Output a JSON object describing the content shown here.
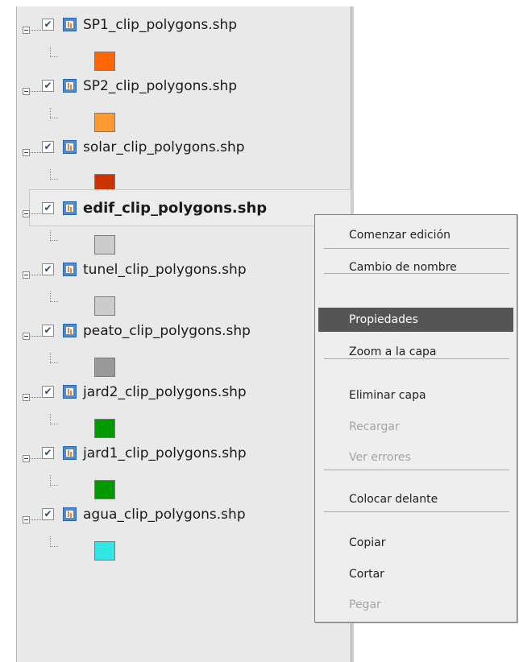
{
  "layers": [
    {
      "name": "SP1_clip_polygons.shp",
      "checked": true,
      "swatch_color": "#ff6600",
      "selected": false
    },
    {
      "name": "SP2_clip_polygons.shp",
      "checked": true,
      "swatch_color": "#ff9933",
      "selected": false
    },
    {
      "name": "solar_clip_polygons.shp",
      "checked": true,
      "swatch_color": "#cc3300",
      "selected": false
    },
    {
      "name": "edif_clip_polygons.shp",
      "checked": true,
      "swatch_color": "#cccccc",
      "selected": true
    },
    {
      "name": "tunel_clip_polygons.shp",
      "checked": true,
      "swatch_color": "#cccccc",
      "selected": false
    },
    {
      "name": "peato_clip_polygons.shp",
      "checked": true,
      "swatch_color": "#999999",
      "selected": false
    },
    {
      "name": "jard2_clip_polygons.shp",
      "checked": true,
      "swatch_color": "#009900",
      "selected": false
    },
    {
      "name": "jard1_clip_polygons.shp",
      "checked": true,
      "swatch_color": "#009900",
      "selected": false
    },
    {
      "name": "agua_clip_polygons.shp",
      "checked": true,
      "swatch_color": "#33e6e6",
      "selected": false
    }
  ],
  "icons": {
    "expander": "minus-box-icon",
    "checkbox": "checkmark-icon",
    "layer": "vector-layer-icon"
  },
  "context_menu": {
    "items": [
      {
        "label": "Comenzar edición",
        "enabled": true,
        "highlighted": false
      },
      {
        "type": "separator"
      },
      {
        "label": "Cambio de nombre",
        "enabled": true,
        "highlighted": false
      },
      {
        "type": "separator"
      },
      {
        "label": "Propiedades",
        "enabled": true,
        "highlighted": true
      },
      {
        "label": "Zoom a la capa",
        "enabled": true,
        "highlighted": false
      },
      {
        "type": "separator"
      },
      {
        "label": "Eliminar capa",
        "enabled": true,
        "highlighted": false
      },
      {
        "label": "Recargar",
        "enabled": false,
        "highlighted": false
      },
      {
        "label": "Ver errores",
        "enabled": false,
        "highlighted": false
      },
      {
        "type": "separator"
      },
      {
        "label": "Colocar delante",
        "enabled": true,
        "highlighted": false
      },
      {
        "type": "separator"
      },
      {
        "label": "Copiar",
        "enabled": true,
        "highlighted": false
      },
      {
        "label": "Cortar",
        "enabled": true,
        "highlighted": false
      },
      {
        "label": "Pegar",
        "enabled": false,
        "highlighted": false
      }
    ]
  }
}
